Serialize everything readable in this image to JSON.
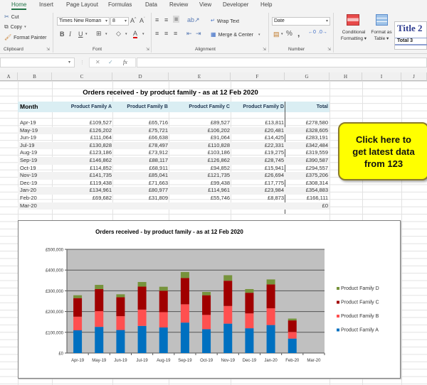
{
  "ribbon": {
    "tabs": [
      "Home",
      "Insert",
      "Page Layout",
      "Formulas",
      "Data",
      "Review",
      "View",
      "Developer",
      "Help"
    ],
    "active_tab": "Home",
    "clipboard": {
      "cut": "Cut",
      "copy": "Copy",
      "format_painter": "Format Painter",
      "label": "Clipboard"
    },
    "font": {
      "name": "Times New Roman",
      "size": "8",
      "label": "Font",
      "bold": "B",
      "italic": "I",
      "underline": "U"
    },
    "alignment": {
      "wrap_text": "Wrap Text",
      "merge_center": "Merge & Center",
      "label": "Alignment"
    },
    "number": {
      "format": "Date",
      "label": "Number",
      "percent": "%",
      "comma": ","
    },
    "styles": {
      "conditional_formatting_1": "Conditional",
      "conditional_formatting_2": "Formatting",
      "format_as_table_1": "Format as",
      "format_as_table_2": "Table",
      "cell_style_title": "Title 2",
      "cell_style_total": "Total 3"
    }
  },
  "formula_bar": {
    "name_box": "",
    "cancel": "✕",
    "enter": "✓",
    "fx": "fx",
    "formula": ""
  },
  "columns": [
    "A",
    "B",
    "C",
    "D",
    "E",
    "F",
    "G",
    "H",
    "I",
    "J"
  ],
  "sheet": {
    "title": "Orders received - by product family - as at 12 Feb 2020",
    "headers": [
      "Month",
      "Product Family A",
      "Product Family B",
      "Product Family C",
      "Product Family D",
      "Total"
    ],
    "rows": [
      [
        "Apr-19",
        "£109,527",
        "£65,716",
        "£89,527",
        "£13,811",
        "£278,580"
      ],
      [
        "May-19",
        "£126,202",
        "£75,721",
        "£106,202",
        "£20,481",
        "£328,605"
      ],
      [
        "Jun-19",
        "£111,064",
        "£66,638",
        "£91,064",
        "£14,425",
        "£283,191"
      ],
      [
        "Jul-19",
        "£130,828",
        "£78,497",
        "£110,828",
        "£22,331",
        "£342,484"
      ],
      [
        "Aug-19",
        "£123,186",
        "£73,912",
        "£103,186",
        "£19,275",
        "£319,559"
      ],
      [
        "Sep-19",
        "£146,862",
        "£88,117",
        "£126,862",
        "£28,745",
        "£390,587"
      ],
      [
        "Oct-19",
        "£114,852",
        "£68,911",
        "£94,852",
        "£15,941",
        "£294,557"
      ],
      [
        "Nov-19",
        "£141,735",
        "£85,041",
        "£121,735",
        "£26,694",
        "£375,206"
      ],
      [
        "Dec-19",
        "£119,438",
        "£71,663",
        "£99,438",
        "£17,775",
        "£308,314"
      ],
      [
        "Jan-20",
        "£134,961",
        "£80,977",
        "£114,961",
        "£23,984",
        "£354,883"
      ],
      [
        "Feb-20",
        "£69,682",
        "£31,809",
        "£55,746",
        "£8,873",
        "£166,111"
      ],
      [
        "Mar-20",
        "",
        "",
        "",
        "",
        "£0"
      ]
    ]
  },
  "cta_button": {
    "line1": "Click here to",
    "line2": "get latest data",
    "line3": "from 123",
    "color": "#ffff00"
  },
  "chart_data": {
    "type": "bar",
    "stacked": true,
    "title": "Orders received - by product family  - as at 12 Feb 2020",
    "xlabel": "",
    "ylabel": "",
    "categories": [
      "Apr-19",
      "May-19",
      "Jun-19",
      "Jul-19",
      "Aug-19",
      "Sep-19",
      "Oct-19",
      "Nov-19",
      "Dec-19",
      "Jan-20",
      "Feb-20",
      "Mar-20"
    ],
    "series": [
      {
        "name": "Product Family A",
        "color": "#0070c0",
        "values": [
          109527,
          126202,
          111064,
          130828,
          123186,
          146862,
          114852,
          141735,
          119438,
          134961,
          69682,
          0
        ]
      },
      {
        "name": "Product Family B",
        "color": "#ff5050",
        "values": [
          65716,
          75721,
          66638,
          78497,
          73912,
          88117,
          68911,
          85041,
          71663,
          80977,
          31809,
          0
        ]
      },
      {
        "name": "Product Family C",
        "color": "#a00000",
        "values": [
          89527,
          106202,
          91064,
          110828,
          103186,
          126862,
          94852,
          121735,
          99438,
          114961,
          55746,
          0
        ]
      },
      {
        "name": "Product Family D",
        "color": "#77933c",
        "values": [
          13811,
          20481,
          14425,
          22331,
          19275,
          28745,
          15941,
          26694,
          17775,
          23984,
          8873,
          0
        ]
      }
    ],
    "ylim": [
      0,
      500000
    ],
    "yticks": [
      0,
      100000,
      200000,
      300000,
      400000,
      500000
    ],
    "ytick_labels": [
      "£0",
      "£100,000",
      "£200,000",
      "£300,000",
      "£400,000",
      "£500,000"
    ],
    "grid": true,
    "plot_background": "#c0c0c0",
    "legend_position": "right",
    "legend_order": [
      "Product Family D",
      "Product Family C",
      "Product Family B",
      "Product Family A"
    ]
  }
}
